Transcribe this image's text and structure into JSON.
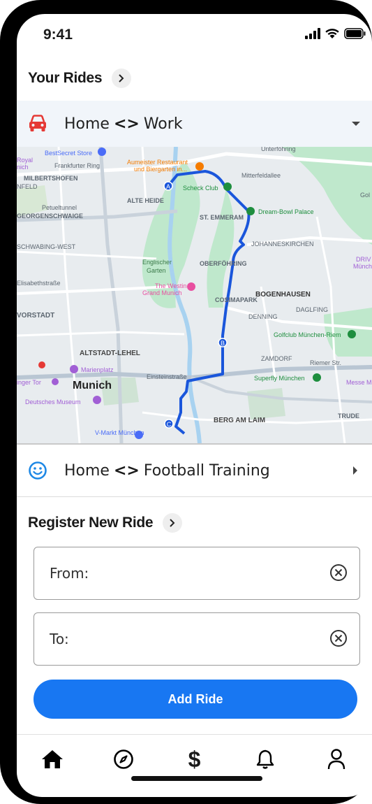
{
  "status_bar": {
    "time": "9:41"
  },
  "your_rides": {
    "title": "Your Rides",
    "items": [
      {
        "from": "Home",
        "to": "Work",
        "icon": "car-icon",
        "icon_color": "#e53935",
        "expanded": true
      },
      {
        "from": "Home",
        "to": "Football Training",
        "icon": "smiley-icon",
        "icon_color": "#1e88e5",
        "expanded": false
      }
    ],
    "swap_symbol": "<>"
  },
  "map": {
    "labels": {
      "bestsecret": "BestSecret Store",
      "royal": "Royal",
      "nich": "nich",
      "frankfurter": "Frankfurter Ring",
      "milbertshofen": "MILBERTSHOFEN",
      "nfeld": "NFELD",
      "aumeister1": "Aumeister Restaurant",
      "aumeister2": "und Biergarten in...",
      "unterfohring": "Unterföhring",
      "mitterfeldallee": "Mitterfeldallee",
      "scheck": "Scheck Club",
      "alte_heide": "ALTE HEIDE",
      "gol": "Gol",
      "petueltunnel": "Petueltunnel",
      "georgenschwaige": "GEORGENSCHWAIGE",
      "st_emmeram": "ST. EMMERAM",
      "dream_bowl": "Dream-Bowl Palace",
      "schwabing": "SCHWABING-WEST",
      "johanneskirchen": "JOHANNESKIRCHEN",
      "englischer1": "Englischer",
      "englischer2": "Garten",
      "oberfohring": "OBERFÖHRING",
      "drive1": "DRIV",
      "drive2": "Münch",
      "elisabeth": "Elisabethstraße",
      "westin1": "The Westin",
      "westin2": "Grand Munich",
      "bogenhausen": "BOGENHAUSEN",
      "cosimapark": "COSIMAPARK",
      "dagling": "DAGLFING",
      "denning": "DENNING",
      "vorstadt": "VORSTADT",
      "golfclub": "Golfclub München-Riem",
      "altstadt": "ALTSTADT-LEHEL",
      "zamdorf": "ZAMDORF",
      "marienplatz": "Marienplatz",
      "munich": "Munich",
      "superfly": "Superfly München",
      "inger_tor": "inger Tor",
      "messe": "Messe M",
      "museum": "Deutsches Museum",
      "trude": "TRUDE",
      "berg": "BERG AM LAIM",
      "vmarkt": "V-Markt München",
      "einstein": "Einsteinstraße",
      "riemer": "Riemer Str."
    },
    "waypoints": [
      "A",
      "B",
      "C"
    ],
    "route_color": "#1a56db"
  },
  "register": {
    "title": "Register New Ride",
    "from_placeholder": "From:",
    "to_placeholder": "To:",
    "button_label": "Add Ride",
    "button_color": "#1877f2"
  },
  "tabbar": {
    "items": [
      "home-icon",
      "compass-icon",
      "dollar-icon",
      "bell-icon",
      "profile-icon"
    ],
    "dollar_glyph": "$"
  }
}
